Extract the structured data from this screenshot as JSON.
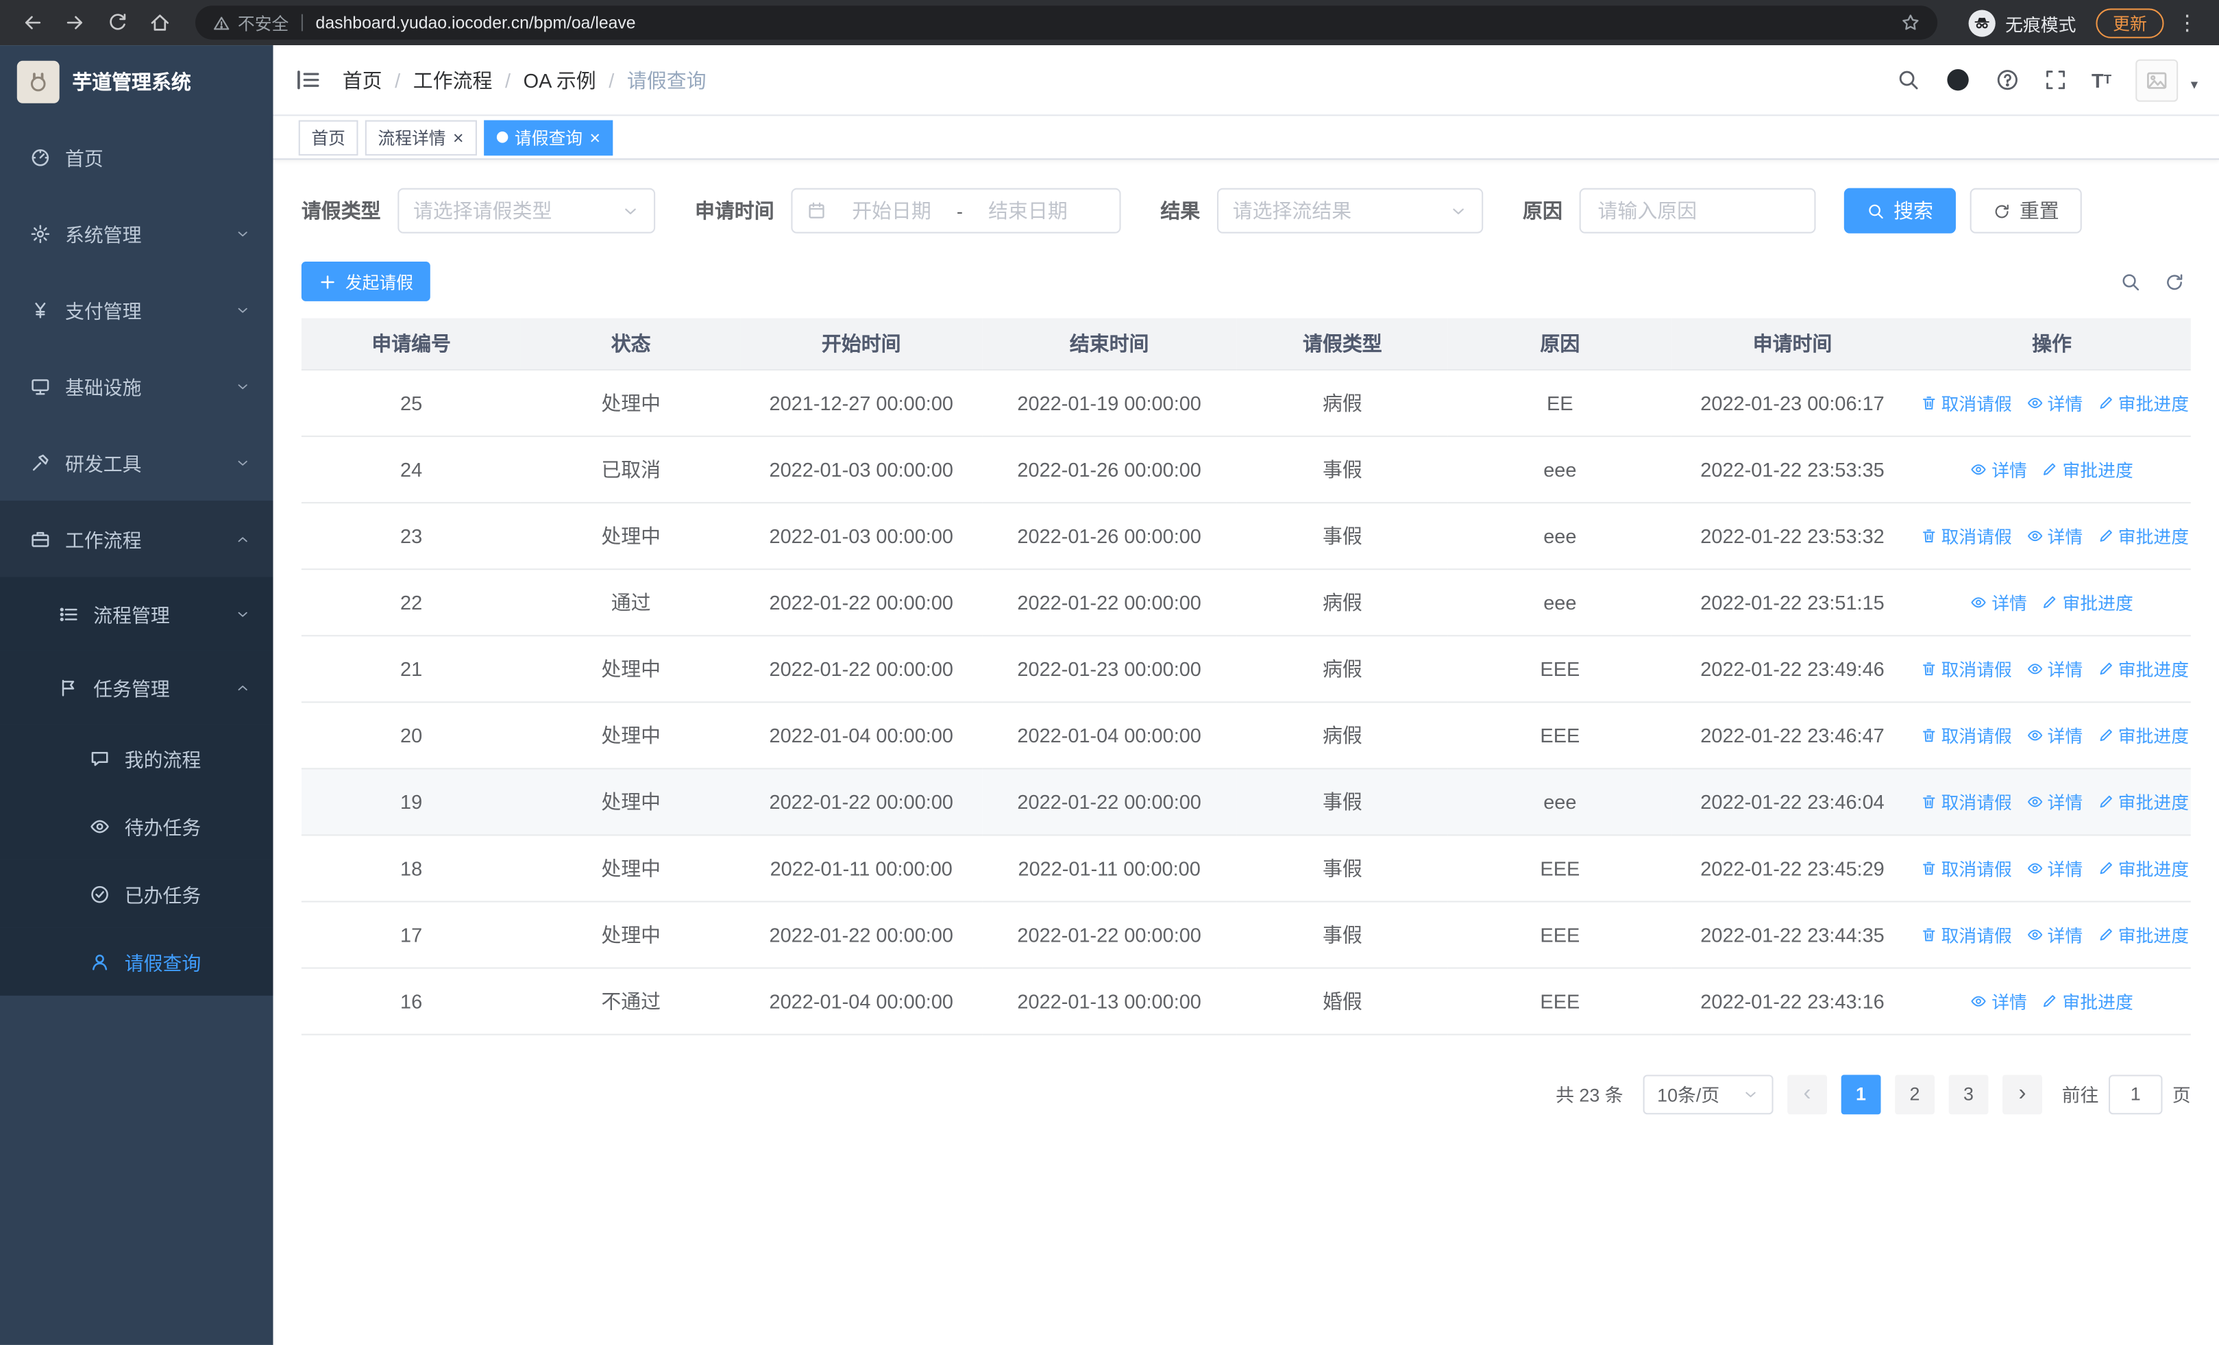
{
  "browser": {
    "security_warning": "不安全",
    "url": "dashboard.yudao.iocoder.cn/bpm/oa/leave",
    "incognito_label": "无痕模式",
    "update_label": "更新"
  },
  "sidebar": {
    "app_title": "芋道管理系统",
    "items": [
      {
        "key": "home",
        "label": "首页",
        "icon": "dashboard-icon",
        "level": 1
      },
      {
        "key": "system",
        "label": "系统管理",
        "icon": "gear-icon",
        "level": 1,
        "arrow": "down"
      },
      {
        "key": "payment",
        "label": "支付管理",
        "icon": "money-icon",
        "level": 1,
        "arrow": "down"
      },
      {
        "key": "infra",
        "label": "基础设施",
        "icon": "infra-icon",
        "level": 1,
        "arrow": "down"
      },
      {
        "key": "devtools",
        "label": "研发工具",
        "icon": "devtools-icon",
        "level": 1,
        "arrow": "down"
      },
      {
        "key": "workflow",
        "label": "工作流程",
        "icon": "workflow-icon",
        "level": 1,
        "arrow": "up",
        "open": true
      },
      {
        "key": "process-mgmt",
        "label": "流程管理",
        "icon": "process-icon",
        "level": 2,
        "arrow": "down"
      },
      {
        "key": "task-mgmt",
        "label": "任务管理",
        "icon": "task-icon",
        "level": 2,
        "arrow": "up",
        "open": true
      },
      {
        "key": "my-process",
        "label": "我的流程",
        "icon": "chat-icon",
        "level": 3
      },
      {
        "key": "todo-task",
        "label": "待办任务",
        "icon": "eye-icon",
        "level": 3
      },
      {
        "key": "done-task",
        "label": "已办任务",
        "icon": "check-circle-icon",
        "level": 3
      },
      {
        "key": "leave-query",
        "label": "请假查询",
        "icon": "user-icon",
        "level": 3,
        "active": true
      }
    ]
  },
  "header": {
    "breadcrumb": [
      "首页",
      "工作流程",
      "OA 示例",
      "请假查询"
    ]
  },
  "tabs": [
    {
      "key": "home",
      "label": "首页",
      "closable": false,
      "active": false
    },
    {
      "key": "process-detail",
      "label": "流程详情",
      "closable": true,
      "active": false
    },
    {
      "key": "leave-query",
      "label": "请假查询",
      "closable": true,
      "active": true
    }
  ],
  "filters": {
    "leave_type_label": "请假类型",
    "leave_type_placeholder": "请选择请假类型",
    "apply_time_label": "申请时间",
    "start_date_placeholder": "开始日期",
    "range_separator": "-",
    "end_date_placeholder": "结束日期",
    "result_label": "结果",
    "result_placeholder": "请选择流结果",
    "reason_label": "原因",
    "reason_placeholder": "请输入原因",
    "search_label": "搜索",
    "reset_label": "重置"
  },
  "toolbar": {
    "create_label": "发起请假"
  },
  "table": {
    "columns": [
      "申请编号",
      "状态",
      "开始时间",
      "结束时间",
      "请假类型",
      "原因",
      "申请时间",
      "操作"
    ],
    "op_labels": {
      "cancel": "取消请假",
      "detail": "详情",
      "progress": "审批进度"
    },
    "rows": [
      {
        "id": "25",
        "status": "处理中",
        "start": "2021-12-27 00:00:00",
        "end": "2022-01-19 00:00:00",
        "type": "病假",
        "reason": "EE",
        "apply_time": "2022-01-23 00:06:17",
        "ops": [
          "cancel",
          "detail",
          "progress"
        ],
        "highlight": false
      },
      {
        "id": "24",
        "status": "已取消",
        "start": "2022-01-03 00:00:00",
        "end": "2022-01-26 00:00:00",
        "type": "事假",
        "reason": "eee",
        "apply_time": "2022-01-22 23:53:35",
        "ops": [
          "detail",
          "progress"
        ],
        "highlight": false
      },
      {
        "id": "23",
        "status": "处理中",
        "start": "2022-01-03 00:00:00",
        "end": "2022-01-26 00:00:00",
        "type": "事假",
        "reason": "eee",
        "apply_time": "2022-01-22 23:53:32",
        "ops": [
          "cancel",
          "detail",
          "progress"
        ],
        "highlight": false
      },
      {
        "id": "22",
        "status": "通过",
        "start": "2022-01-22 00:00:00",
        "end": "2022-01-22 00:00:00",
        "type": "病假",
        "reason": "eee",
        "apply_time": "2022-01-22 23:51:15",
        "ops": [
          "detail",
          "progress"
        ],
        "highlight": false
      },
      {
        "id": "21",
        "status": "处理中",
        "start": "2022-01-22 00:00:00",
        "end": "2022-01-23 00:00:00",
        "type": "病假",
        "reason": "EEE",
        "apply_time": "2022-01-22 23:49:46",
        "ops": [
          "cancel",
          "detail",
          "progress"
        ],
        "highlight": false
      },
      {
        "id": "20",
        "status": "处理中",
        "start": "2022-01-04 00:00:00",
        "end": "2022-01-04 00:00:00",
        "type": "病假",
        "reason": "EEE",
        "apply_time": "2022-01-22 23:46:47",
        "ops": [
          "cancel",
          "detail",
          "progress"
        ],
        "highlight": false
      },
      {
        "id": "19",
        "status": "处理中",
        "start": "2022-01-22 00:00:00",
        "end": "2022-01-22 00:00:00",
        "type": "事假",
        "reason": "eee",
        "apply_time": "2022-01-22 23:46:04",
        "ops": [
          "cancel",
          "detail",
          "progress"
        ],
        "highlight": true
      },
      {
        "id": "18",
        "status": "处理中",
        "start": "2022-01-11 00:00:00",
        "end": "2022-01-11 00:00:00",
        "type": "事假",
        "reason": "EEE",
        "apply_time": "2022-01-22 23:45:29",
        "ops": [
          "cancel",
          "detail",
          "progress"
        ],
        "highlight": false
      },
      {
        "id": "17",
        "status": "处理中",
        "start": "2022-01-22 00:00:00",
        "end": "2022-01-22 00:00:00",
        "type": "事假",
        "reason": "EEE",
        "apply_time": "2022-01-22 23:44:35",
        "ops": [
          "cancel",
          "detail",
          "progress"
        ],
        "highlight": false
      },
      {
        "id": "16",
        "status": "不通过",
        "start": "2022-01-04 00:00:00",
        "end": "2022-01-13 00:00:00",
        "type": "婚假",
        "reason": "EEE",
        "apply_time": "2022-01-22 23:43:16",
        "ops": [
          "detail",
          "progress"
        ],
        "highlight": false
      }
    ]
  },
  "pagination": {
    "total_text": "共 23 条",
    "page_size_text": "10条/页",
    "pages": [
      "1",
      "2",
      "3"
    ],
    "active_page": "1",
    "goto_label": "前往",
    "goto_value": "1",
    "goto_suffix": "页"
  },
  "colors": {
    "accent": "#409eff",
    "sidebar_bg": "#304156",
    "sidebar_sub_bg": "#1f2d3d",
    "update_orange": "#ef9545"
  }
}
